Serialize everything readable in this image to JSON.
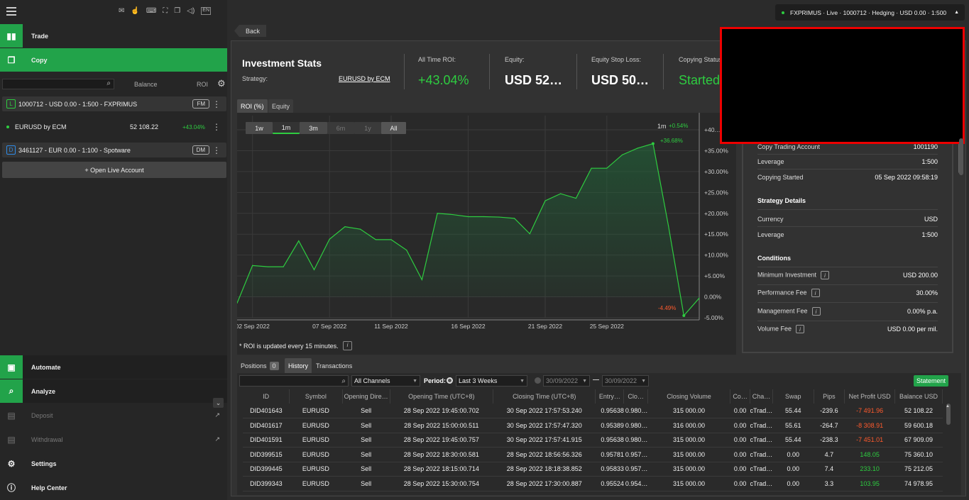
{
  "header": {
    "menu_icon": "hamburger-icon",
    "account_summary": "FXPRIMUS · Live · 1000712 · Hedging · USD 0.00 · 1:500"
  },
  "toolbar_icons": [
    "mail-icon",
    "hand-icon",
    "keyboard-icon",
    "fullscreen-icon",
    "layers-icon",
    "sound-icon",
    "language-icon"
  ],
  "language": "EN",
  "nav": {
    "trade": "Trade",
    "copy": "Copy",
    "automate": "Automate",
    "analyze": "Analyze",
    "deposit": "Deposit",
    "withdrawal": "Withdrawal",
    "settings": "Settings",
    "help": "Help Center"
  },
  "list_header": {
    "balance": "Balance",
    "roi": "ROI"
  },
  "accounts": [
    {
      "type": "L",
      "label": "1000712 - USD 0.00 - 1:500 - FXPRIMUS",
      "tag": "FM"
    },
    {
      "label": "EURUSD by ECM",
      "balance": "52 108.22",
      "roi": "+43.04%"
    },
    {
      "type": "D",
      "label": "3461127 - EUR 0.00 - 1:100 - Spotware",
      "tag": "DM"
    }
  ],
  "open_live": "+ Open Live Account",
  "back": "Back",
  "stats": {
    "title": "Investment Stats",
    "strategy_label": "Strategy:",
    "strategy": "EURUSD by ECM",
    "roi_label": "All Time ROI:",
    "roi": "+43.04%",
    "equity_label": "Equity:",
    "equity": "USD 52…",
    "stoploss_label": "Equity Stop Loss:",
    "stoploss": "USD 50…",
    "status_label": "Copying Status:",
    "status": "Started"
  },
  "chart_tabs": [
    "ROI (%)",
    "Equity"
  ],
  "ranges": [
    "1w",
    "1m",
    "3m",
    "6m",
    "1y",
    "All"
  ],
  "chart_info": {
    "period": "1m",
    "change": "+0.54%",
    "max_label": "+36.68%",
    "min_label": "-4.49%",
    "note": "* ROI is updated every 15 minutes."
  },
  "chart_data": {
    "type": "area",
    "ylim": [
      -5,
      40
    ],
    "yticks": [
      "+40.…",
      "+35.00%",
      "+30.00%",
      "+25.00%",
      "+20.00%",
      "+15.00%",
      "+10.00%",
      "+5.00%",
      "0.00%",
      "-5.00%"
    ],
    "xticks": [
      "02 Sep 2022",
      "07 Sep 2022",
      "11 Sep 2022",
      "16 Sep 2022",
      "21 Sep 2022",
      "25 Sep 2022"
    ],
    "x": [
      0,
      1,
      2,
      3,
      4,
      5,
      6,
      7,
      8,
      9,
      10,
      11,
      12,
      13,
      14,
      15,
      16,
      17,
      18,
      19,
      20,
      21,
      22,
      23,
      24,
      25,
      26,
      27,
      28,
      29,
      30
    ],
    "values": [
      -1.5,
      7.5,
      7.2,
      7.2,
      13.4,
      6.5,
      13.8,
      16.8,
      16.2,
      13.7,
      13.7,
      11.2,
      4.1,
      20,
      19.7,
      19.2,
      19.2,
      19.1,
      18.8,
      15.1,
      23,
      24.7,
      23.6,
      30.8,
      30.8,
      34,
      35.6,
      36.68,
      17,
      -4.49,
      -0.3
    ]
  },
  "details": {
    "copy_account_label": "Copy Trading Account",
    "copy_account": "1001190",
    "leverage_label": "Leverage",
    "leverage": "1:500",
    "started_label": "Copying Started",
    "started": "05 Sep 2022 09:58:19",
    "strategy_header": "Strategy Details",
    "currency_label": "Currency",
    "currency": "USD",
    "s_leverage_label": "Leverage",
    "s_leverage": "1:500",
    "conditions_header": "Conditions",
    "min_inv_label": "Minimum Investment",
    "min_inv": "USD 200.00",
    "perf_fee_label": "Performance Fee",
    "perf_fee": "30.00%",
    "mgmt_fee_label": "Management Fee",
    "mgmt_fee": "0.00% p.a.",
    "vol_fee_label": "Volume Fee",
    "vol_fee": "USD 0.00 per mil."
  },
  "bottom_tabs": {
    "positions": "Positions",
    "positions_count": "0",
    "history": "History",
    "transactions": "Transactions"
  },
  "filters": {
    "channels": "All Channels",
    "period_label": "Period:",
    "period": "Last 3 Weeks",
    "from": "30/09/2022",
    "to": "30/09/2022",
    "statement": "Statement"
  },
  "table": {
    "columns": [
      "ID",
      "Symbol",
      "Opening Dire…",
      "Opening Time (UTC+8)",
      "Closing Time (UTC+8)",
      "Entry…",
      "Clo…",
      "Closing Volume",
      "Co…",
      "Cha…",
      "Swap",
      "Pips",
      "Net Profit USD",
      "Balance USD"
    ],
    "rows": [
      [
        "DID401643",
        "EURUSD",
        "Sell",
        "28 Sep 2022 19:45:00.702",
        "30 Sep 2022 17:57:53.240",
        "0.95638",
        "0.980…",
        "315 000.00",
        "0.00",
        "cTrad…",
        "55.44",
        "-239.6",
        "-7 491.96",
        "52 108.22"
      ],
      [
        "DID401617",
        "EURUSD",
        "Sell",
        "28 Sep 2022 15:00:00.511",
        "30 Sep 2022 17:57:47.320",
        "0.95389",
        "0.980…",
        "316 000.00",
        "0.00",
        "cTrad…",
        "55.61",
        "-264.7",
        "-8 308.91",
        "59 600.18"
      ],
      [
        "DID401591",
        "EURUSD",
        "Sell",
        "28 Sep 2022 19:45:00.757",
        "30 Sep 2022 17:57:41.915",
        "0.95638",
        "0.980…",
        "315 000.00",
        "0.00",
        "cTrad…",
        "55.44",
        "-238.3",
        "-7 451.01",
        "67 909.09"
      ],
      [
        "DID399515",
        "EURUSD",
        "Sell",
        "28 Sep 2022 18:30:00.581",
        "28 Sep 2022 18:56:56.326",
        "0.95781",
        "0.957…",
        "315 000.00",
        "0.00",
        "cTrad…",
        "0.00",
        "4.7",
        "148.05",
        "75 360.10"
      ],
      [
        "DID399445",
        "EURUSD",
        "Sell",
        "28 Sep 2022 18:15:00.714",
        "28 Sep 2022 18:18:38.852",
        "0.95833",
        "0.957…",
        "315 000.00",
        "0.00",
        "cTrad…",
        "0.00",
        "7.4",
        "233.10",
        "75 212.05"
      ],
      [
        "DID399343",
        "EURUSD",
        "Sell",
        "28 Sep 2022 15:30:00.754",
        "28 Sep 2022 17:30:00.887",
        "0.95524",
        "0.954…",
        "315 000.00",
        "0.00",
        "cTrad…",
        "0.00",
        "3.3",
        "103.95",
        "74 978.95"
      ]
    ]
  }
}
